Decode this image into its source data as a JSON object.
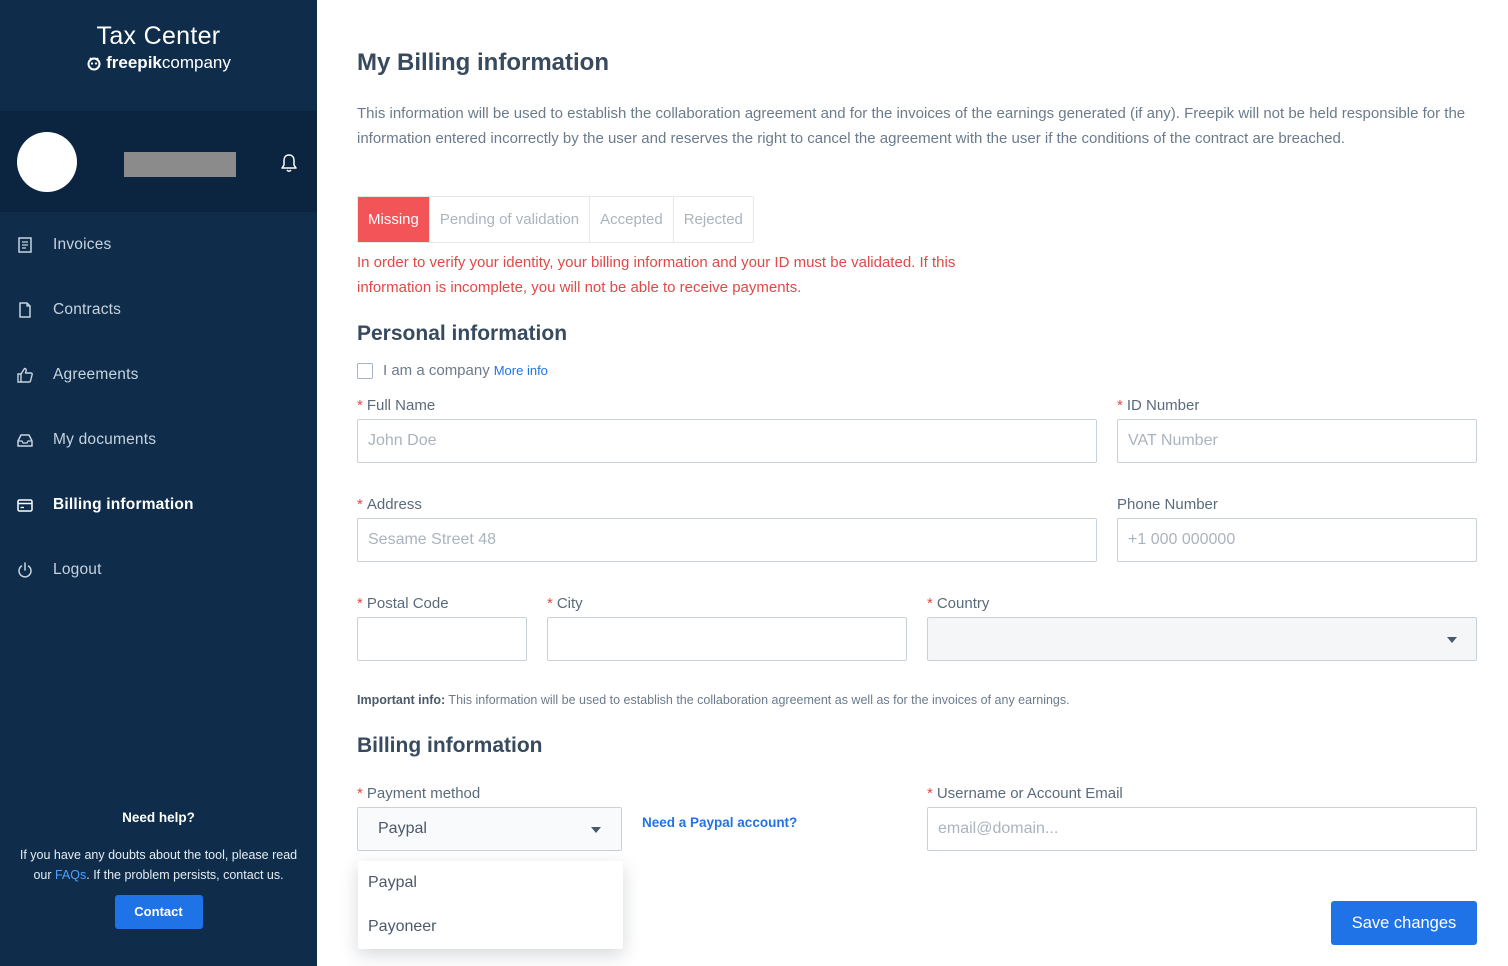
{
  "sidebar": {
    "brand_title": "Tax Center",
    "brand_sub_strong": "freepik",
    "brand_sub_rest": "company",
    "nav": [
      {
        "label": "Invoices",
        "icon": "receipt-icon"
      },
      {
        "label": "Contracts",
        "icon": "document-icon"
      },
      {
        "label": "Agreements",
        "icon": "thumbs-up-icon"
      },
      {
        "label": "My documents",
        "icon": "inbox-icon"
      },
      {
        "label": "Billing information",
        "icon": "card-icon",
        "active": true
      },
      {
        "label": "Logout",
        "icon": "power-icon"
      }
    ],
    "help": {
      "title": "Need help?",
      "text_before": "If you have any doubts about the tool, please read our ",
      "faq_link": "FAQs",
      "text_after": ". If the problem persists, contact us.",
      "contact_label": "Contact"
    }
  },
  "main": {
    "title": "My Billing information",
    "intro": "This information will be used to establish the collaboration agreement and for the invoices of the earnings generated (if any). Freepik will not be held responsible for the information entered incorrectly by the user and reserves the right to cancel the agreement with the user if the conditions of the contract are breached.",
    "status_tabs": [
      "Missing",
      "Pending of validation",
      "Accepted",
      "Rejected"
    ],
    "active_status": "Missing",
    "warning": "In order to verify your identity, your billing information and your ID must be validated. If this information is incomplete, you will not be able to receive payments.",
    "personal": {
      "title": "Personal information",
      "company_label": "I am a company",
      "more_info": "More info",
      "full_name_label": "Full Name",
      "full_name_placeholder": "John Doe",
      "id_label": "ID Number",
      "id_placeholder": "VAT Number",
      "address_label": "Address",
      "address_placeholder": "Sesame Street 48",
      "phone_label": "Phone Number",
      "phone_placeholder": "+1 000 000000",
      "postal_label": "Postal Code",
      "city_label": "City",
      "country_label": "Country",
      "important_bold": "Important info:",
      "important_text": " This information will be used to establish the collaboration agreement as well as for the invoices of any earnings."
    },
    "billing": {
      "title": "Billing information",
      "payment_label": "Payment method",
      "payment_value": "Paypal",
      "paypal_link": "Need a Paypal account?",
      "payment_options": [
        "Paypal",
        "Payoneer"
      ],
      "account_label": "Username or Account Email",
      "account_placeholder": "email@domain..."
    },
    "save_label": "Save changes"
  },
  "colors": {
    "sidebar_bg": "#0f2d4a",
    "user_panel_bg": "#0b2540",
    "accent": "#1f73e6",
    "missing": "#f25457",
    "warning_text": "#e34848"
  }
}
